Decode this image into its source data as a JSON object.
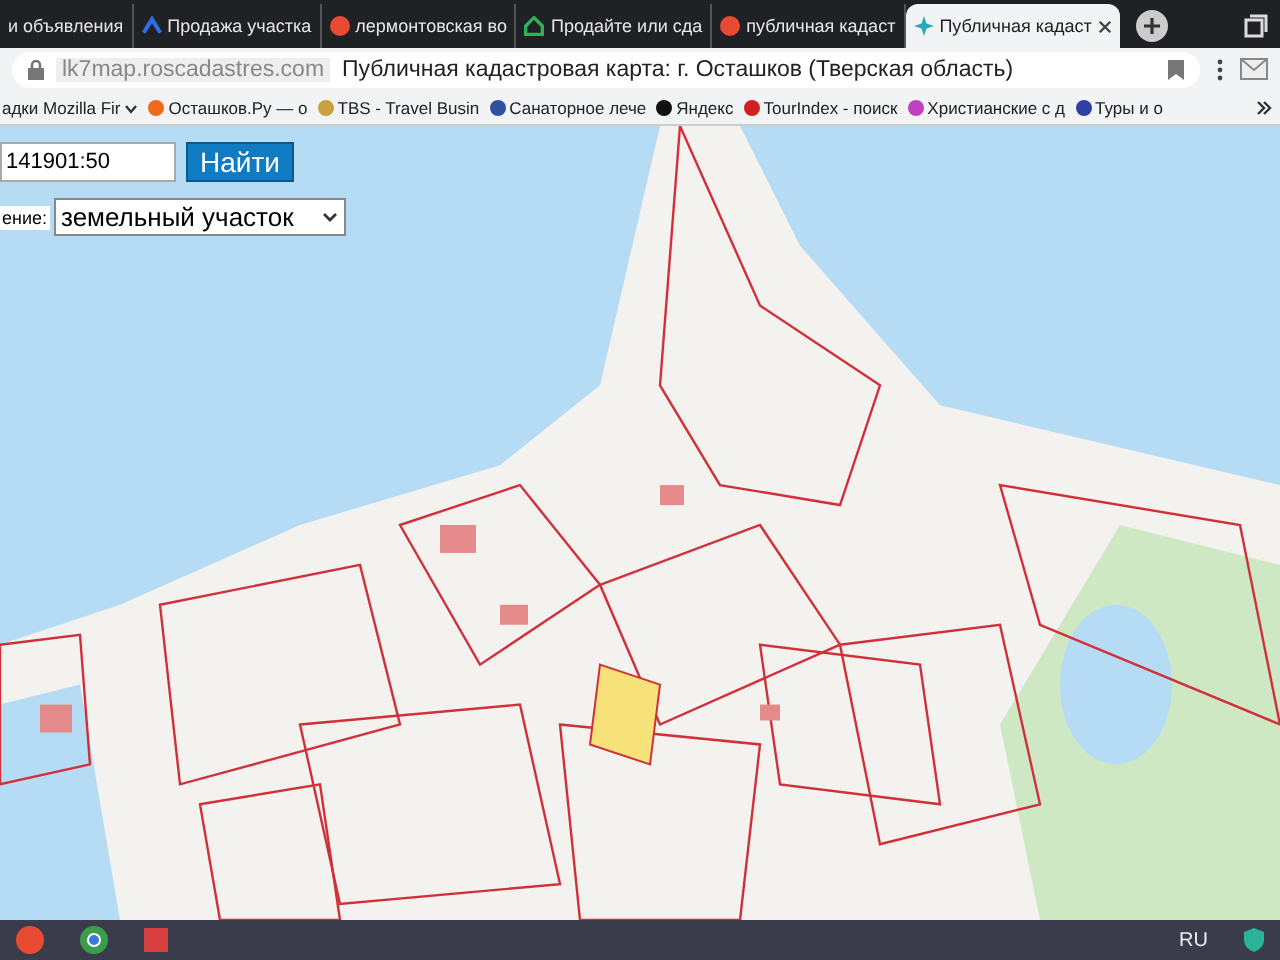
{
  "tabs": [
    {
      "label": "и объявления",
      "selected": false
    },
    {
      "label": "Продажа участка",
      "selected": false
    },
    {
      "label": "лермонтовская во",
      "selected": false
    },
    {
      "label": "Продайте или сда",
      "selected": false
    },
    {
      "label": "публичная кадаст",
      "selected": false
    },
    {
      "label": "Публичная кадаст",
      "selected": true
    }
  ],
  "address_bar": {
    "domain": "lk7map.roscadastres.com",
    "page_title": "Публичная кадастровая карта: г. Осташков (Тверская область)"
  },
  "bookmarks": [
    "адки Mozilla Fir",
    "Осташков.Ру — о",
    "TBS - Travel Busin",
    "Санаторное лече",
    "Яндекс",
    "TourIndex - поиск",
    "Христианские с д",
    "Туры и о"
  ],
  "search": {
    "value": "141901:50",
    "button": "Найти"
  },
  "type_filter": {
    "label": "ение:",
    "value": "земельный участок"
  },
  "taskbar": {
    "language": "RU"
  }
}
